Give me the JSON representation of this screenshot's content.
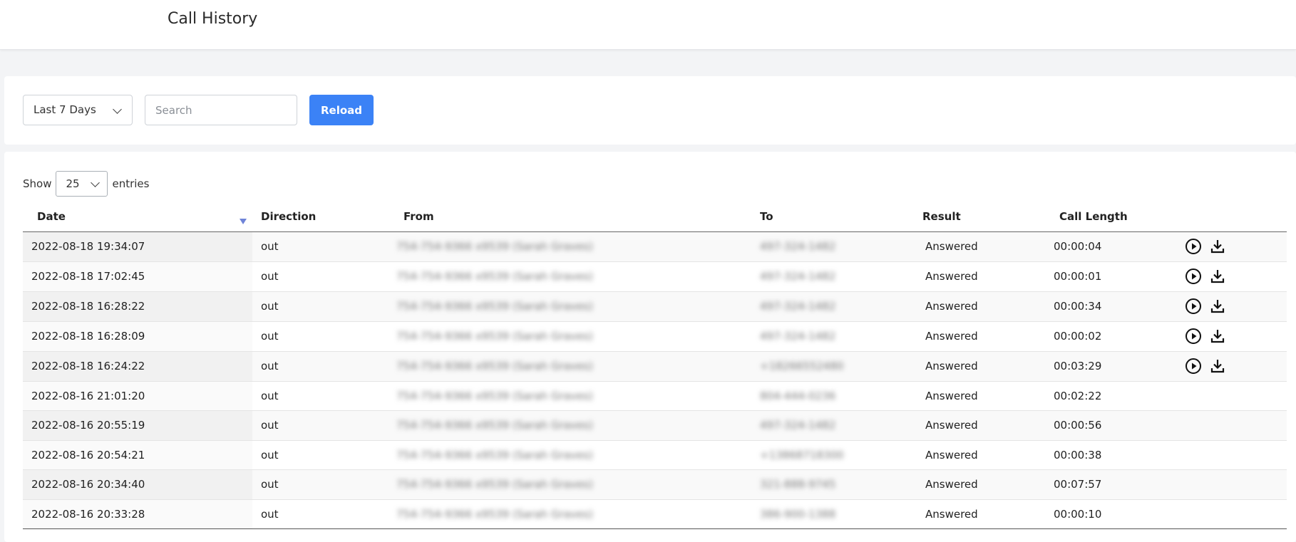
{
  "header": {
    "title": "Call History"
  },
  "filters": {
    "range_value": "Last 7 Days",
    "search_placeholder": "Search",
    "search_value": "",
    "reload_label": "Reload"
  },
  "table_controls": {
    "show_label": "Show",
    "page_length": "25",
    "entries_label": "entries"
  },
  "table": {
    "columns": {
      "date": "Date",
      "direction": "Direction",
      "from": "From",
      "to": "To",
      "result": "Result",
      "length": "Call Length"
    },
    "sort_column": "date",
    "sort_order": "descending",
    "rows": [
      {
        "date": "2022-08-18 19:34:07",
        "direction": "out",
        "from": "754-754-9366 x9539 (Sarah Graves)",
        "to": "497-324-1482",
        "result": "Answered",
        "length": "00:00:04",
        "has_recording": true
      },
      {
        "date": "2022-08-18 17:02:45",
        "direction": "out",
        "from": "754-754-9366 x9539 (Sarah Graves)",
        "to": "497-324-1482",
        "result": "Answered",
        "length": "00:00:01",
        "has_recording": true
      },
      {
        "date": "2022-08-18 16:28:22",
        "direction": "out",
        "from": "754-754-9366 x9539 (Sarah Graves)",
        "to": "497-324-1482",
        "result": "Answered",
        "length": "00:00:34",
        "has_recording": true
      },
      {
        "date": "2022-08-18 16:28:09",
        "direction": "out",
        "from": "754-754-9366 x9539 (Sarah Graves)",
        "to": "497-324-1482",
        "result": "Answered",
        "length": "00:00:02",
        "has_recording": true
      },
      {
        "date": "2022-08-18 16:24:22",
        "direction": "out",
        "from": "754-754-9366 x9539 (Sarah Graves)",
        "to": "+18266552480",
        "result": "Answered",
        "length": "00:03:29",
        "has_recording": true
      },
      {
        "date": "2022-08-16 21:01:20",
        "direction": "out",
        "from": "754-754-9366 x9539 (Sarah Graves)",
        "to": "804-444-0236",
        "result": "Answered",
        "length": "00:02:22",
        "has_recording": false
      },
      {
        "date": "2022-08-16 20:55:19",
        "direction": "out",
        "from": "754-754-9366 x9539 (Sarah Graves)",
        "to": "497-324-1482",
        "result": "Answered",
        "length": "00:00:56",
        "has_recording": false
      },
      {
        "date": "2022-08-16 20:54:21",
        "direction": "out",
        "from": "754-754-9366 x9539 (Sarah Graves)",
        "to": "+13868718300",
        "result": "Answered",
        "length": "00:00:38",
        "has_recording": false
      },
      {
        "date": "2022-08-16 20:34:40",
        "direction": "out",
        "from": "754-754-9366 x9539 (Sarah Graves)",
        "to": "321-888-9745",
        "result": "Answered",
        "length": "00:07:57",
        "has_recording": false
      },
      {
        "date": "2022-08-16 20:33:28",
        "direction": "out",
        "from": "754-754-9366 x9539 (Sarah Graves)",
        "to": "386-900-1388",
        "result": "Answered",
        "length": "00:00:10",
        "has_recording": false
      }
    ]
  },
  "icons": {
    "play": "play-circle-icon",
    "download": "download-icon",
    "sort": "sort-desc-icon",
    "dropdown": "chevron-down-icon"
  },
  "colors": {
    "accent": "#3b82f6",
    "sort_indicator": "#6f84d8"
  }
}
